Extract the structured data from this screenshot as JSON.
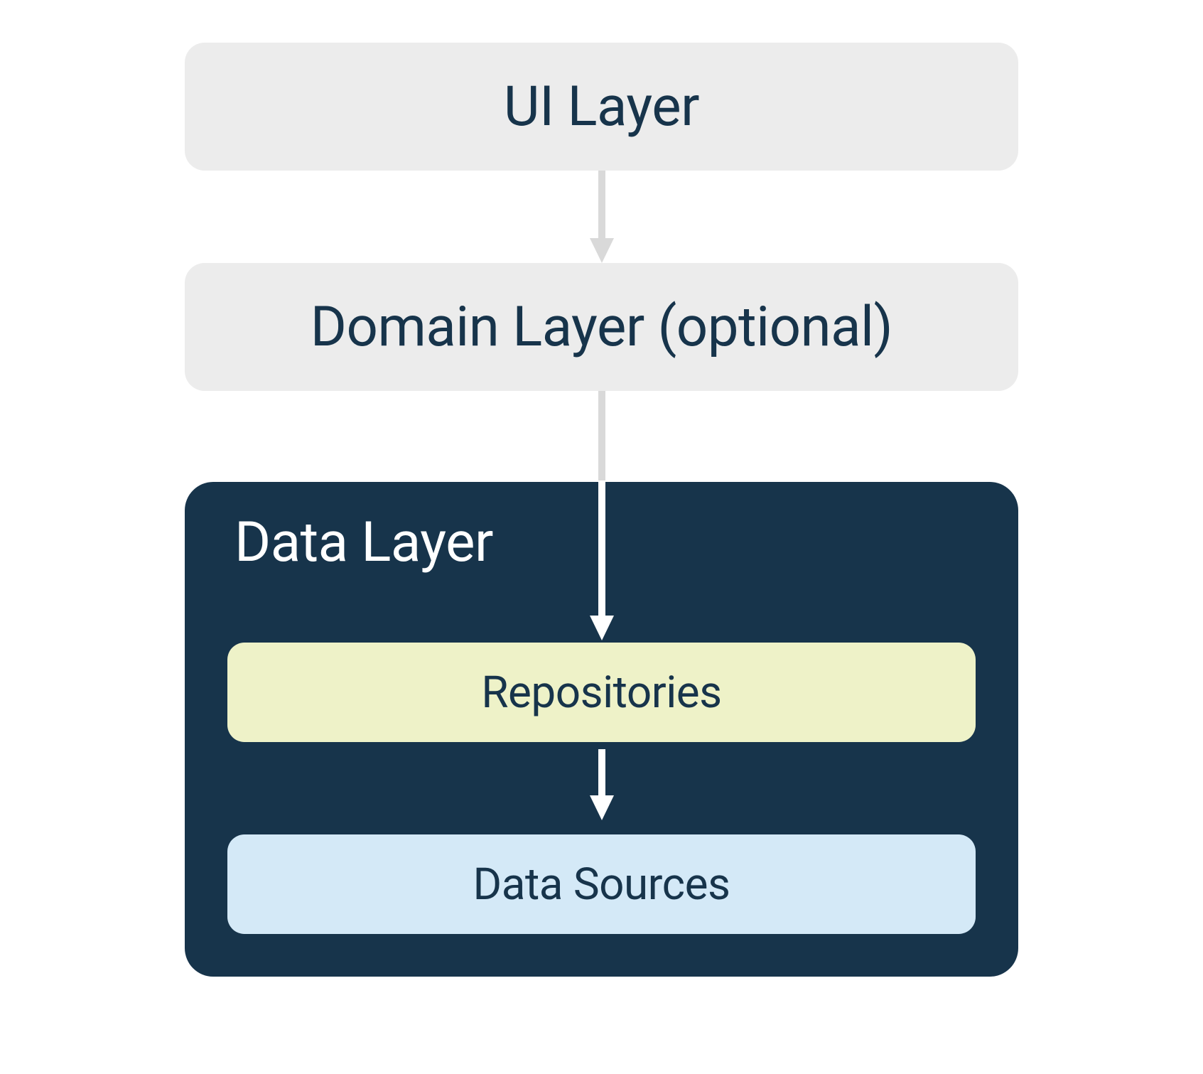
{
  "layers": {
    "ui": "UI Layer",
    "domain": "Domain Layer (optional)",
    "data": {
      "title": "Data Layer",
      "repositories": "Repositories",
      "dataSources": "Data Sources"
    }
  },
  "colors": {
    "lightGrey": "#ececec",
    "darkNavy": "#17344b",
    "limeTint": "#eef2c8",
    "blueTint": "#d4e9f7",
    "white": "#ffffff"
  }
}
